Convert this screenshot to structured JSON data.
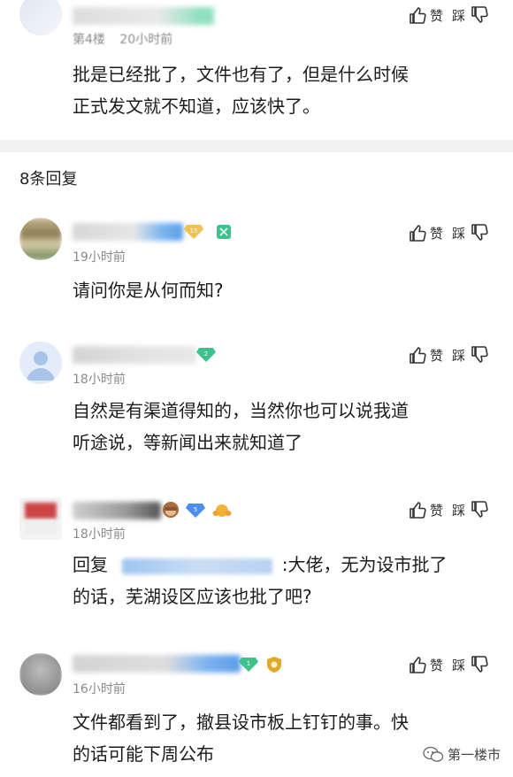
{
  "top_comment": {
    "floor": "第4楼",
    "time": "20小时前",
    "text_line1": "批是已经批了，文件也有了，但是什么时候",
    "text_line2": "正式发文就不知道，应该快了。",
    "like_label": "赞",
    "dislike_label": "踩"
  },
  "replies_header": "8条回复",
  "replies": [
    {
      "time": "19小时前",
      "text_line1": "请问你是从何而知?",
      "text_line2": "",
      "badge": "15",
      "like_label": "赞",
      "dislike_label": "踩"
    },
    {
      "time": "18小时前",
      "text_line1": "自然是有渠道得知的，当然你也可以说我道",
      "text_line2": "听途说，等新闻出来就知道了",
      "badge": "2",
      "like_label": "赞",
      "dislike_label": "踩"
    },
    {
      "time": "18小时前",
      "reply_prefix": "回复",
      "text_line1_rest": ":大佬，无为设市批了",
      "text_line2": "的话，芜湖设区应该也批了吧?",
      "badge": "5",
      "like_label": "赞",
      "dislike_label": "踩"
    },
    {
      "time": "16小时前",
      "text_line1": "文件都看到了，撤县设市板上钉钉的事。快",
      "text_line2": "的话可能下周公布",
      "badge": "1",
      "like_label": "赞",
      "dislike_label": "踩"
    }
  ],
  "watermark": "第一楼市",
  "colors": {
    "accent_blue": "#4a90e2",
    "badge_gold": "#f2c14e",
    "badge_green": "#3cc28a",
    "badge_blue": "#4a8ff0"
  },
  "icons": [
    "thumb-up-icon",
    "thumb-down-icon",
    "wechat-icon"
  ]
}
